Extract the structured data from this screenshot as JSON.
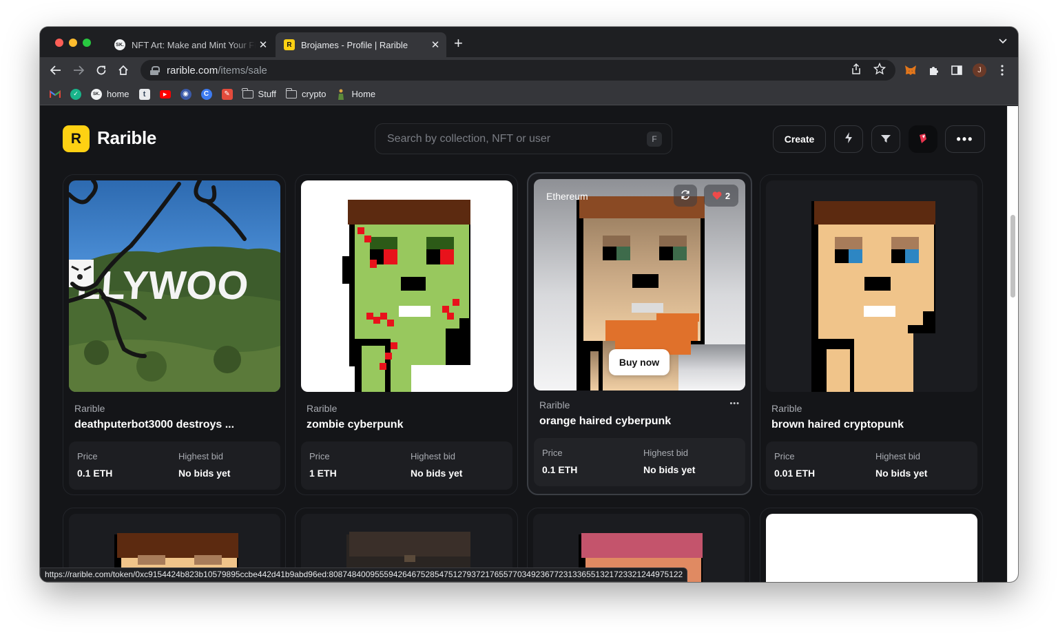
{
  "browser": {
    "tabs": [
      {
        "favicon": "SK.",
        "title": "NFT Art: Make and Mint Your First NFT",
        "close": "✕"
      },
      {
        "favicon": "R",
        "title": "Brojames - Profile | Rarible",
        "close": "✕"
      }
    ],
    "new_tab": "+",
    "tab_menu": "⌄",
    "url_host": "rarible.com",
    "url_path": "/items/sale",
    "avatar_initial": "J",
    "bookmarks": [
      {
        "label": "",
        "icon": "gmail-icon"
      },
      {
        "label": "",
        "icon": "shield-check-icon"
      },
      {
        "label": "home",
        "icon": "sk-icon"
      },
      {
        "label": "",
        "icon": "tumblr-icon"
      },
      {
        "label": "",
        "icon": "youtube-icon"
      },
      {
        "label": "",
        "icon": "globe-icon"
      },
      {
        "label": "",
        "icon": "c-icon"
      },
      {
        "label": "",
        "icon": "tool-icon"
      },
      {
        "label": "Stuff",
        "icon": "folder-icon"
      },
      {
        "label": "crypto",
        "icon": "folder-icon"
      },
      {
        "label": "Home",
        "icon": "person-icon"
      }
    ],
    "status_url": "https://rarible.com/token/0xc9154424b823b10579895ccbe442d41b9abd96ed:80874840095559426467528547512793721765577034923677231336551321723321244975122"
  },
  "header": {
    "logo_letter": "R",
    "brand": "Rarible",
    "search_placeholder": "Search by collection, NFT or user",
    "search_shortcut": "F",
    "create_label": "Create",
    "more_label": "•••"
  },
  "cards": [
    {
      "collection": "Rarible",
      "name": "deathputerbot3000 destroys ...",
      "price_label": "Price",
      "price": "0.1 ETH",
      "bid_label": "Highest bid",
      "bid": "No bids yet"
    },
    {
      "collection": "Rarible",
      "name": "zombie cyberpunk",
      "price_label": "Price",
      "price": "1 ETH",
      "bid_label": "Highest bid",
      "bid": "No bids yet"
    },
    {
      "collection": "Rarible",
      "name": "orange haired cyberpunk",
      "price_label": "Price",
      "price": "0.1 ETH",
      "bid_label": "Highest bid",
      "bid": "No bids yet",
      "chain": "Ethereum",
      "likes": "2",
      "buy_label": "Buy now",
      "more": "•••"
    },
    {
      "collection": "Rarible",
      "name": "brown haired cryptopunk",
      "price_label": "Price",
      "price": "0.01 ETH",
      "bid_label": "Highest bid",
      "bid": "No bids yet"
    }
  ],
  "image_text": {
    "hollywood_sign": "LLYWOO"
  }
}
